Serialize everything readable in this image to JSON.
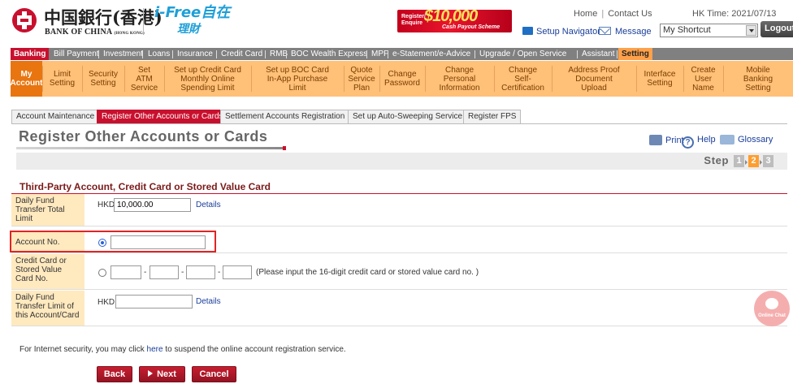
{
  "header": {
    "logo_cn": "中国銀行(香港)",
    "logo_en": "BANK OF CHINA",
    "logo_en_sub": "(HONG KONG)",
    "ifree_top": "i-Free自在",
    "ifree_bottom": "理財",
    "promo_left": "Register/ Enquire",
    "promo_amount": "$10,000",
    "promo_sub": "Cash Payout Scheme",
    "home": "Home",
    "contact": "Contact Us",
    "hk_time": "HK Time: 2021/07/13",
    "setup_navigator": "Setup Navigator",
    "message": "Message",
    "shortcut": "My Shortcut",
    "logout": "Logout"
  },
  "menu": [
    "Banking",
    "Bill Payment",
    "Investment",
    "Loans",
    "Insurance",
    "Credit Card",
    "RMB",
    "BOC Wealth Express",
    "MPF",
    "e-Statement/e-Advice",
    "Upgrade / Open Service",
    "Assistant",
    "Setting"
  ],
  "submenu": [
    "My Account",
    "Limit Setting",
    "Security Setting",
    "Set ATM Service",
    "Set up Credit Card Monthly Online Spending Limit",
    "Set up BOC Card In-App Purchase Limit",
    "Quote Service Plan",
    "Change Password",
    "Change Personal Information",
    "Change Self-Certification",
    "Address Proof Document Upload",
    "Interface Setting",
    "Create User Name",
    "Mobile Banking Setting"
  ],
  "tabs": [
    "Account Maintenance",
    "Register Other Accounts or Cards",
    "Settlement Accounts Registration",
    "Set up Auto-Sweeping Service",
    "Register FPS"
  ],
  "page": {
    "title": "Register Other Accounts or Cards",
    "print": "Print",
    "help": "Help",
    "glossary": "Glossary",
    "step_label": "Step",
    "steps": [
      "1",
      "2",
      "3"
    ],
    "current_step": 2
  },
  "section": {
    "title": "Third-Party Account, Credit Card or Stored Value Card",
    "daily_total_label": "Daily Fund Transfer Total Limit",
    "currency": "HKD",
    "daily_total_value": "10,000.00",
    "details": "Details",
    "account_no_label": "Account No.",
    "account_no_value": "",
    "card_label": "Credit Card or Stored Value Card No.",
    "card_hint": "(Please input the 16-digit credit card or stored value card no. )",
    "daily_account_label": "Daily Fund Transfer Limit of this Account/Card",
    "daily_account_value": "",
    "dash": "-"
  },
  "footer": {
    "note_before": "For Internet security, you may click ",
    "note_link": "here",
    "note_after": " to suspend the online account registration service.",
    "back": "Back",
    "next": "Next",
    "cancel": "Cancel"
  },
  "chat": {
    "label": "Online Chat"
  }
}
